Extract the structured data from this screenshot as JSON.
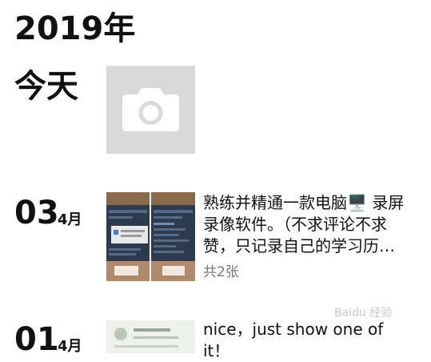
{
  "header": {
    "year": "2019年",
    "today": "今天"
  },
  "today_tile": {
    "icon": "camera-icon"
  },
  "entries": [
    {
      "day": "03",
      "month": "4月",
      "text": "熟练并精通一款电脑🖥️ 录屏录像软件。（不求评论不求赞，只记录自己的学习历…",
      "count": "共2张"
    },
    {
      "day": "01",
      "month": "4月",
      "text": "nice，just show one of it！"
    }
  ],
  "watermark": "Baidu 经验"
}
